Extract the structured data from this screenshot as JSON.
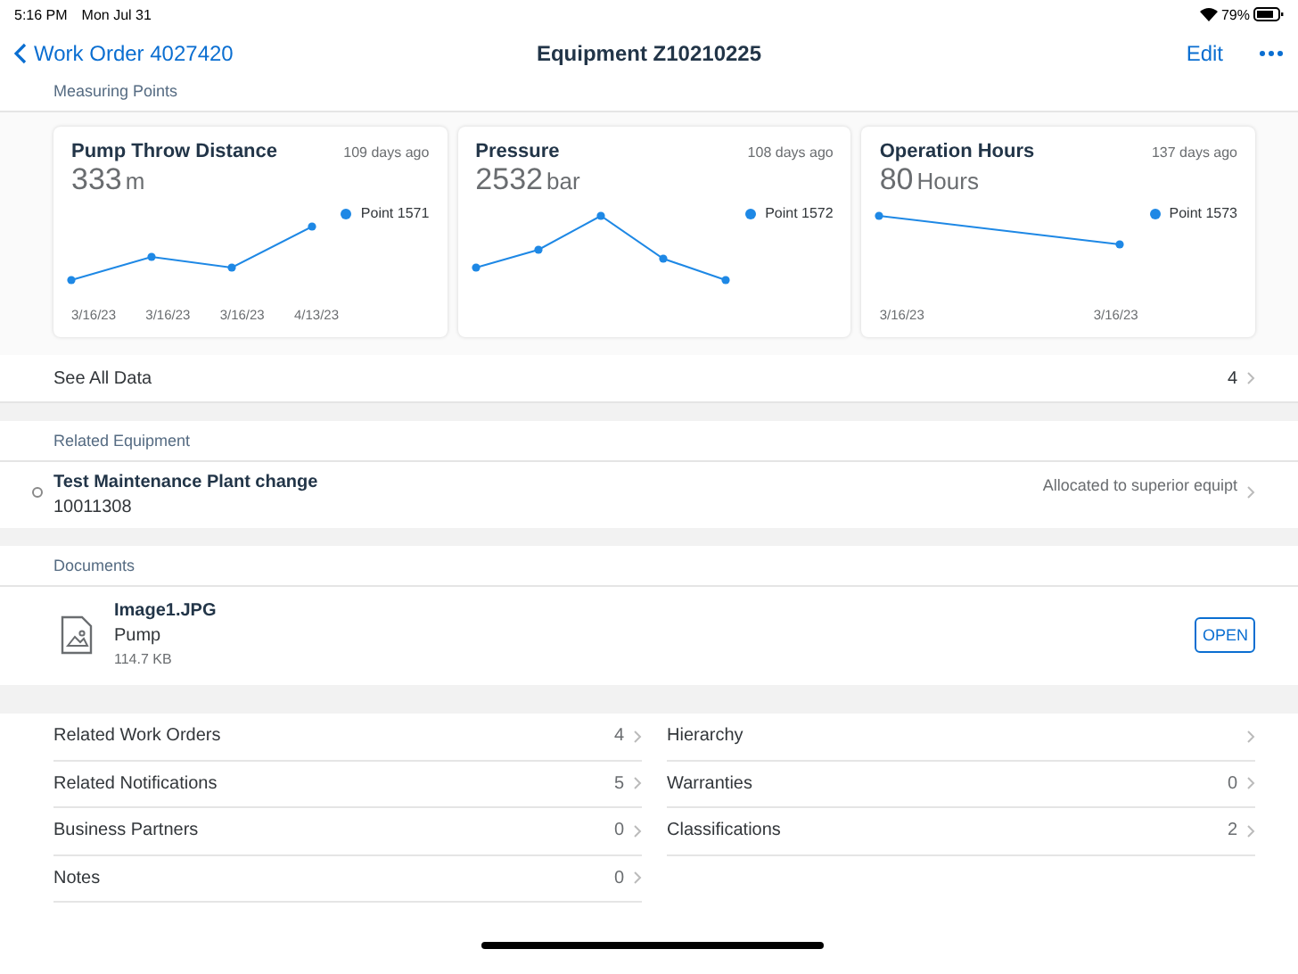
{
  "status_bar": {
    "time": "5:16 PM",
    "date": "Mon Jul 31",
    "battery": "79%"
  },
  "nav": {
    "back": "Work Order 4027420",
    "title": "Equipment Z10210225",
    "edit": "Edit"
  },
  "measuring_points": {
    "header": "Measuring Points",
    "cards": [
      {
        "title": "Pump Throw Distance",
        "age": "109 days ago",
        "value": "333",
        "unit": "m",
        "legend": "Point 1571",
        "x_labels": [
          "3/16/23",
          "3/16/23",
          "3/16/23",
          "4/13/23"
        ]
      },
      {
        "title": "Pressure",
        "age": "108 days ago",
        "value": "2532",
        "unit": "bar",
        "legend": "Point 1572"
      },
      {
        "title": "Operation Hours",
        "age": "137 days ago",
        "value": "80",
        "unit": "Hours",
        "legend": "Point 1573",
        "x_labels": [
          "3/16/23",
          "3/16/23"
        ]
      }
    ],
    "see_all": {
      "label": "See All Data",
      "count": "4"
    }
  },
  "related_equipment": {
    "header": "Related Equipment",
    "items": [
      {
        "title": "Test Maintenance Plant change",
        "id": "10011308",
        "status": "Allocated to superior equipt"
      }
    ]
  },
  "documents": {
    "header": "Documents",
    "items": [
      {
        "name": "Image1.JPG",
        "description": "Pump",
        "size": "114.7 KB",
        "action": "OPEN"
      }
    ]
  },
  "links": [
    {
      "label": "Related Work Orders",
      "count": "4"
    },
    {
      "label": "Hierarchy"
    },
    {
      "label": "Related Notifications",
      "count": "5"
    },
    {
      "label": "Warranties",
      "count": "0"
    },
    {
      "label": "Business Partners",
      "count": "0"
    },
    {
      "label": "Classifications",
      "count": "2"
    },
    {
      "label": "Notes",
      "count": "0"
    }
  ]
}
